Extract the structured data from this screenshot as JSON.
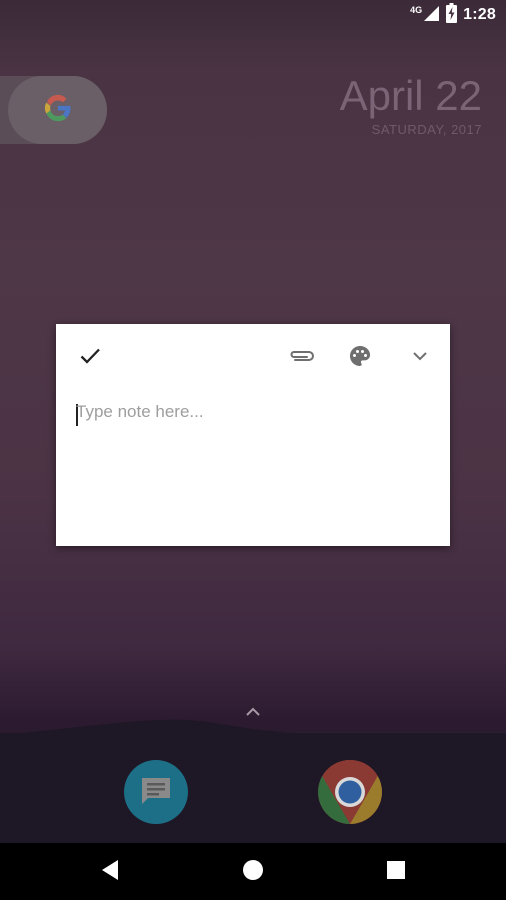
{
  "status_bar": {
    "network_label": "4G",
    "time": "1:28"
  },
  "home": {
    "date_main": "April 22",
    "date_sub": "SATURDAY, 2017",
    "google_icon": "google-g-icon"
  },
  "note_dialog": {
    "placeholder": "Type note here...",
    "value": "",
    "icons": [
      "check-icon",
      "attachment-icon",
      "palette-icon",
      "chevron-down-icon"
    ]
  },
  "dock": {
    "apps": [
      "messages-app",
      "chrome-app"
    ]
  },
  "nav": {
    "icons": [
      "back-icon",
      "home-icon",
      "recents-icon"
    ]
  },
  "colors": {
    "accent_text": "#9e9e9e",
    "card_bg": "#ffffff"
  }
}
